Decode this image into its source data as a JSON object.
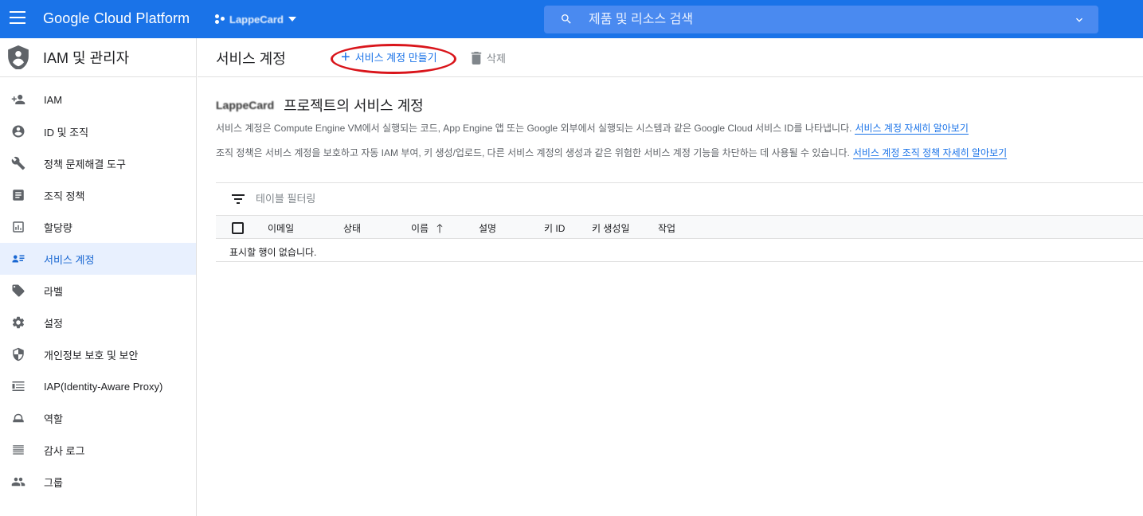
{
  "topbar": {
    "brand": "Google Cloud Platform",
    "project_name": "LappeCard",
    "search_placeholder": "제품 및 리소스 검색",
    "bg_color": "#1a73e8"
  },
  "sidebar": {
    "title": "IAM 및 관리자",
    "items": [
      {
        "label": "IAM",
        "icon": "person-add-icon"
      },
      {
        "label": "ID 및 조직",
        "icon": "account-circle-icon"
      },
      {
        "label": "정책 문제해결 도구",
        "icon": "wrench-icon"
      },
      {
        "label": "조직 정책",
        "icon": "document-icon"
      },
      {
        "label": "할당량",
        "icon": "quota-icon"
      },
      {
        "label": "서비스 계정",
        "icon": "service-account-icon",
        "active": true
      },
      {
        "label": "라벨",
        "icon": "label-icon"
      },
      {
        "label": "설정",
        "icon": "gear-icon"
      },
      {
        "label": "개인정보 보호 및 보안",
        "icon": "shield-icon"
      },
      {
        "label": "IAP(Identity-Aware Proxy)",
        "icon": "iap-icon"
      },
      {
        "label": "역할",
        "icon": "role-icon"
      },
      {
        "label": "감사 로그",
        "icon": "list-icon"
      },
      {
        "label": "그룹",
        "icon": "group-icon"
      }
    ]
  },
  "main": {
    "page_title": "서비스 계정",
    "create_label": "서비스 계정 만들기",
    "delete_label": "삭제",
    "project_name": "LappeCard",
    "heading": "프로젝트의 서비스 계정",
    "desc1": "서비스 계정은 Compute Engine VM에서 실행되는 코드, App Engine 앱 또는 Google 외부에서 실행되는 시스템과 같은 Google Cloud 서비스 ID를 나타냅니다.",
    "desc1_link": "서비스 계정 자세히 알아보기",
    "desc2": "조직 정책은 서비스 계정을 보호하고 자동 IAM 부여, 키 생성/업로드, 다른 서비스 계정의 생성과 같은 위험한 서비스 계정 기능을 차단하는 데 사용될 수 있습니다.",
    "desc2_link": "서비스 계정 조직 정책 자세히 알아보기",
    "filter_placeholder": "테이블 필터링",
    "table": {
      "columns": [
        "이메일",
        "상태",
        "이름",
        "설명",
        "키 ID",
        "키 생성일",
        "작업"
      ],
      "sorted_column": "이름",
      "sort_direction": "ascending",
      "empty_message": "표시할 행이 없습니다."
    },
    "highlight_color": "#d9151b"
  }
}
